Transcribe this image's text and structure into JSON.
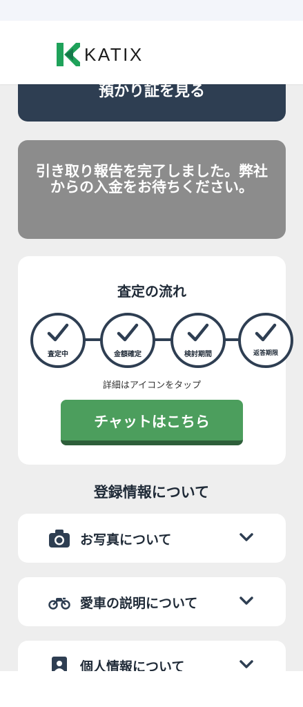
{
  "header": {
    "logo_text": "KATIX"
  },
  "receipt_button": {
    "label": "預かり証を見る"
  },
  "notice": {
    "message": "引き取り報告を完了しました。弊社からの入金をお待ちください。"
  },
  "flow": {
    "title": "査定の流れ",
    "steps": [
      {
        "label": "査定中",
        "icon": "check-icon"
      },
      {
        "label": "金額確定",
        "icon": "check-icon"
      },
      {
        "label": "検討期間",
        "icon": "check-icon"
      },
      {
        "label": "返答期限",
        "icon": "check-icon"
      }
    ],
    "hint": "詳細はアイコンをタップ",
    "chat_button": "チャットはこちら"
  },
  "registration": {
    "title": "登録情報について",
    "items": [
      {
        "label": "お写真について",
        "icon": "camera-icon"
      },
      {
        "label": "愛車の説明について",
        "icon": "motorcycle-icon"
      },
      {
        "label": "個人情報について",
        "icon": "person-card-icon"
      }
    ]
  },
  "colors": {
    "navy": "#2e3e52",
    "green": "#4c9e5d",
    "gray": "#8c8c8c",
    "logo_green": "#1fa25a"
  }
}
